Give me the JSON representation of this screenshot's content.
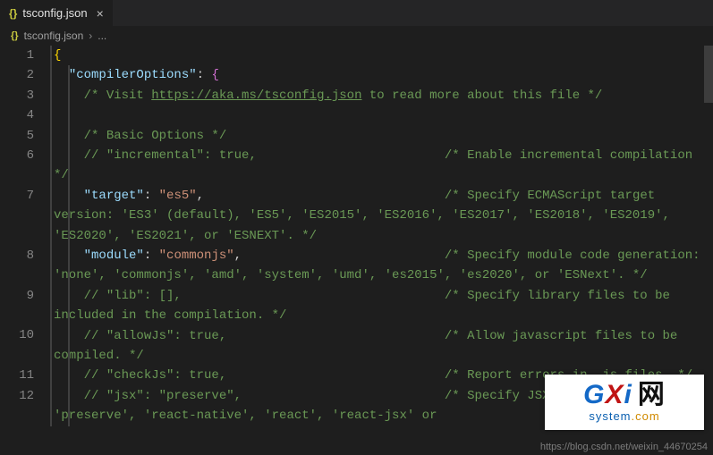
{
  "tab": {
    "filename": "tsconfig.json",
    "icon_label": "{}"
  },
  "breadcrumb": {
    "filename": "tsconfig.json",
    "icon_label": "{}",
    "more": "..."
  },
  "editor": {
    "lines": [
      {
        "num": "1",
        "content": [
          {
            "t": "brace",
            "v": "{"
          }
        ]
      },
      {
        "num": "2",
        "content": [
          {
            "t": "pad",
            "w": 2
          },
          {
            "t": "key",
            "v": "\"compilerOptions\""
          },
          {
            "t": "punct",
            "v": ": "
          },
          {
            "t": "brace2",
            "v": "{"
          }
        ]
      },
      {
        "num": "3",
        "content": [
          {
            "t": "pad",
            "w": 4
          },
          {
            "t": "comment",
            "v": "/* Visit "
          },
          {
            "t": "link",
            "v": "https://aka.ms/tsconfig.json"
          },
          {
            "t": "comment",
            "v": " to read more about this file */"
          }
        ]
      },
      {
        "num": "4",
        "content": []
      },
      {
        "num": "5",
        "content": [
          {
            "t": "pad",
            "w": 4
          },
          {
            "t": "comment",
            "v": "/* Basic Options */"
          }
        ]
      },
      {
        "num": "6",
        "content": [
          {
            "t": "pad",
            "w": 4
          },
          {
            "t": "comment",
            "v": "// \"incremental\": true,                         /* Enable incremental compilation */"
          }
        ]
      },
      {
        "num": "7",
        "content": [
          {
            "t": "pad",
            "w": 4
          },
          {
            "t": "key",
            "v": "\"target\""
          },
          {
            "t": "punct",
            "v": ": "
          },
          {
            "t": "str",
            "v": "\"es5\""
          },
          {
            "t": "punct",
            "v": ","
          },
          {
            "t": "comment",
            "v": "                                /* Specify ECMAScript target version: 'ES3' (default), 'ES5', 'ES2015', 'ES2016', 'ES2017', 'ES2018', 'ES2019', 'ES2020', 'ES2021', or 'ESNEXT'. */"
          }
        ]
      },
      {
        "num": "8",
        "content": [
          {
            "t": "pad",
            "w": 4
          },
          {
            "t": "key",
            "v": "\"module\""
          },
          {
            "t": "punct",
            "v": ": "
          },
          {
            "t": "str",
            "v": "\"commonjs\""
          },
          {
            "t": "punct",
            "v": ","
          },
          {
            "t": "comment",
            "v": "                           /* Specify module code generation: 'none', 'commonjs', 'amd', 'system', 'umd', 'es2015', 'es2020', or 'ESNext'. */"
          }
        ]
      },
      {
        "num": "9",
        "content": [
          {
            "t": "pad",
            "w": 4
          },
          {
            "t": "comment",
            "v": "// \"lib\": [],                                   /* Specify library files to be included in the compilation. */"
          }
        ]
      },
      {
        "num": "10",
        "content": [
          {
            "t": "pad",
            "w": 4
          },
          {
            "t": "comment",
            "v": "// \"allowJs\": true,                             /* Allow javascript files to be compiled. */"
          }
        ]
      },
      {
        "num": "11",
        "content": [
          {
            "t": "pad",
            "w": 4
          },
          {
            "t": "comment",
            "v": "// \"checkJs\": true,                             /* Report errors in .js files. */"
          }
        ]
      },
      {
        "num": "12",
        "content": [
          {
            "t": "pad",
            "w": 4
          },
          {
            "t": "comment",
            "v": "// \"jsx\": \"preserve\",                           /* Specify JSX code generation: 'preserve', 'react-native', 'react', 'react-jsx' or"
          }
        ]
      }
    ]
  },
  "watermark": "https://blog.csdn.net/weixin_44670254",
  "logo": {
    "g": "G",
    "x": "X",
    "i": "i",
    "wang": "网",
    "sub1": "system",
    "sub2": ".com"
  }
}
